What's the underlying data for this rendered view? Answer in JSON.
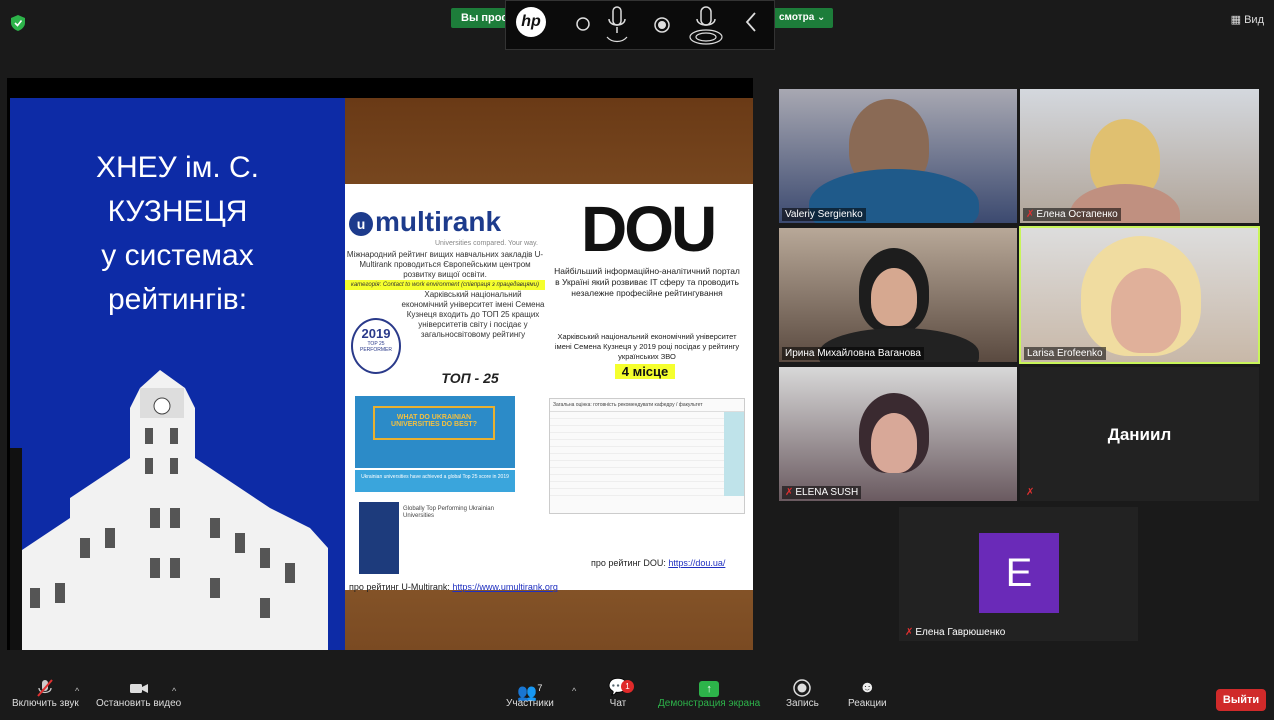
{
  "top": {
    "banner_left": "Вы прос",
    "banner_right": "смотра ⌄",
    "view_label": "Вид",
    "hp_logo": "hp"
  },
  "slide": {
    "title_lines": [
      "ХНЕУ ім. С.",
      "КУЗНЕЦЯ",
      "у системах",
      "рейтингів:"
    ],
    "multirank": {
      "logo_text": "multirank",
      "logo_sub": "Universities compared. Your way.",
      "desc": "Міжнародний рейтинг вищих навчальних закладів U-Multirank проводиться Європейським центром розвитку вищої освіти.",
      "highlight": "категорія: Contact to work environment (співпраця з працедавцями)",
      "desc2": "Харківський національний економічний університет імені Семена Кузнеця входить до ТОП 25 кращих університетів світу і посідає у загальносвітовому рейтингу",
      "badge_year": "2019",
      "badge_text": "TOP 25 PERFORMER",
      "top25": "ТОП - 25",
      "box_title": "WHAT DO UKRAINIAN UNIVERSITIES DO BEST?",
      "box_sub": "Ukrainian universities have achieved a global Top 25 score in 2019",
      "article_title": "Globally Top Performing Ukrainian Universities",
      "link_prefix": "про рейтинг U-Multirank: ",
      "link_url": "https://www.umultirank.org"
    },
    "dou": {
      "logo": "DOU",
      "desc": "Найбільший інформаційно-аналітичний портал в Україні який розвиває IT сферу та проводить незалежне професійне рейтингування",
      "desc2": "Харківський національний економічний університет імені Семена Кузнеця у 2019 році посідає у рейтингу українських ЗВО",
      "place": "4 місце",
      "table_header": "Загальна оцінка: готовність рекомендувати кафедру / факультет",
      "link_prefix": "про рейтинг DOU: ",
      "link_url": "https://dou.ua/"
    }
  },
  "participants": [
    {
      "name": "Valeriy Sergienko",
      "muted": false
    },
    {
      "name": "Елена Остапенко",
      "muted": true
    },
    {
      "name": "Ирина Михайловна Ваганова",
      "muted": false
    },
    {
      "name": "Larisa Erofeenko",
      "muted": false
    },
    {
      "name": "ELENA SUSH",
      "muted": true
    },
    {
      "name": "Даниил",
      "muted": true
    },
    {
      "name": "Елена Гаврюшенко",
      "muted": true,
      "avatar_letter": "E"
    }
  ],
  "toolbar": {
    "mute_label": "Включить звук",
    "video_label": "Остановить видео",
    "participants_label": "Участники",
    "participants_count": "7",
    "chat_label": "Чат",
    "chat_badge": "1",
    "share_label": "Демонстрация экрана",
    "record_label": "Запись",
    "reactions_label": "Реакции",
    "leave_label": "Выйти"
  },
  "colors": {
    "accent_green": "#2db34a",
    "leave_red": "#d02a2a",
    "active_border": "#c9f55a",
    "avatar_purple": "#6a2ab8"
  }
}
